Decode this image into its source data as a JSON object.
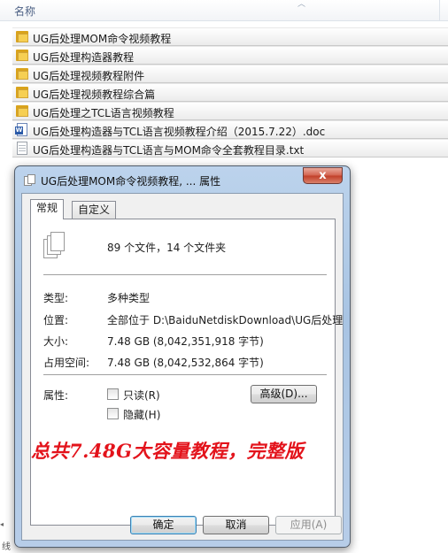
{
  "explorer": {
    "column_name": "名称",
    "files": [
      {
        "type": "folder",
        "name": "UG后处理MOM命令视频教程"
      },
      {
        "type": "folder",
        "name": "UG后处理构造器教程"
      },
      {
        "type": "folder",
        "name": "UG后处理视频教程附件"
      },
      {
        "type": "folder",
        "name": "UG后处理视频教程综合篇"
      },
      {
        "type": "folder",
        "name": "UG后处理之TCL语言视频教程"
      },
      {
        "type": "doc",
        "name": "UG后处理构造器与TCL语言视频教程介绍（2015.7.22）.doc"
      },
      {
        "type": "txt",
        "name": "UG后处理构造器与TCL语言与MOM命令全套教程目录.txt"
      }
    ],
    "bottom_label": "线"
  },
  "dialog": {
    "title": "UG后处理MOM命令视频教程, ... 属性",
    "close_glyph": "x",
    "tabs": [
      "常规",
      "自定义"
    ],
    "summary": "89 个文件，14 个文件夹",
    "properties": {
      "type_label": "类型:",
      "type_value": "多种类型",
      "location_label": "位置:",
      "location_value": "全部位于 D:\\BaiduNetdiskDownload\\UG后处理",
      "size_label": "大小:",
      "size_value": "7.48 GB (8,042,351,918 字节)",
      "disk_label": "占用空间:",
      "disk_value": "7.48 GB (8,042,532,864 字节)"
    },
    "attributes": {
      "label": "属性:",
      "readonly_label": "只读(R)",
      "readonly_checked": false,
      "hidden_label": "隐藏(H)",
      "hidden_checked": false,
      "advanced_button": "高级(D)..."
    },
    "promo_text": "总共7.48G大容量教程，完整版",
    "buttons": {
      "ok": "确定",
      "cancel": "取消",
      "apply": "应用(A)"
    }
  }
}
